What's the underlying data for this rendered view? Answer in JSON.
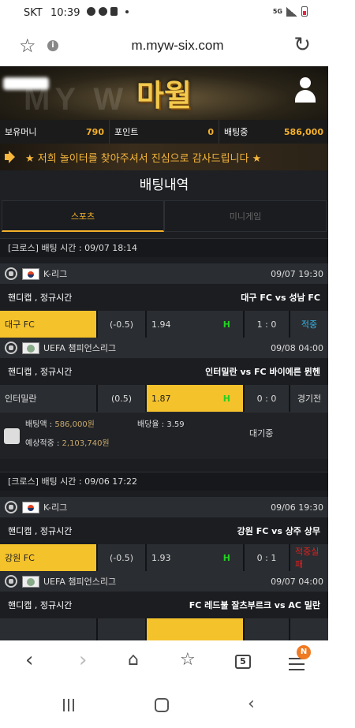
{
  "statusbar": {
    "carrier": "SKT",
    "time": "10:39"
  },
  "browser": {
    "url": "m.myw-six.com",
    "tab_count": "5",
    "badge": "N"
  },
  "site": {
    "logo": "마월",
    "ghost_text": "MY W"
  },
  "wallet": {
    "balance_label": "보유머니",
    "balance": "790",
    "points_label": "포인트",
    "points": "0",
    "betting_label": "배팅중",
    "betting": "586,000"
  },
  "notice": "★ 저희 놀이터를 찾아주셔서 진심으로 감사드립니다 ★",
  "page_title": "배팅내역",
  "tabs": {
    "sports": "스포츠",
    "minigame": "미니게임"
  },
  "bets": [
    {
      "header": "[크로스] 배팅 시간 : 09/07 18:14",
      "matches": [
        {
          "league": "K-리그",
          "time": "09/07 19:30",
          "market": "핸디캡 , 정규시간",
          "teams": "대구 FC  vs  성남 FC",
          "home": "대구 FC",
          "line": "(-0.5)",
          "odds": "1.94",
          "mark": "H",
          "score": "1 : 0",
          "result": "적중"
        },
        {
          "league": "UEFA 챔피언스리그",
          "time": "09/08 04:00",
          "market": "핸디캡 , 정규시간",
          "teams": "인터밀란  vs  FC 바이에른 뮌헨",
          "home": "인터밀란",
          "line": "(0.5)",
          "odds": "1.87",
          "mark": "H",
          "score": "0 : 0",
          "result": "경기전"
        }
      ],
      "summary": {
        "amount_label": "배팅액 : ",
        "amount": "586,000원",
        "rate_label": "배당율 : ",
        "rate": "3.59",
        "expected_label": "예상적중 : ",
        "expected": "2,103,740원",
        "status": "대기중"
      }
    },
    {
      "header": "[크로스] 배팅 시간 : 09/06 17:22",
      "matches": [
        {
          "league": "K-리그",
          "time": "09/06 19:30",
          "market": "핸디캡 , 정규시간",
          "teams": "강원 FC  vs  상주 상무",
          "home": "강원 FC",
          "line": "(-0.5)",
          "odds": "1.93",
          "mark": "H",
          "score": "0 : 1",
          "result": "적중실패"
        },
        {
          "league": "UEFA 챔피언스리그",
          "time": "09/07 04:00",
          "market": "핸디캡 , 정규시간",
          "teams": "FC 레드불 잘츠부르크  vs  AC 밀란"
        }
      ]
    }
  ],
  "colors": {
    "accent": "#f4c22b",
    "hit": "#38b6e8",
    "miss": "#e02020",
    "h_mark": "#22d222"
  }
}
